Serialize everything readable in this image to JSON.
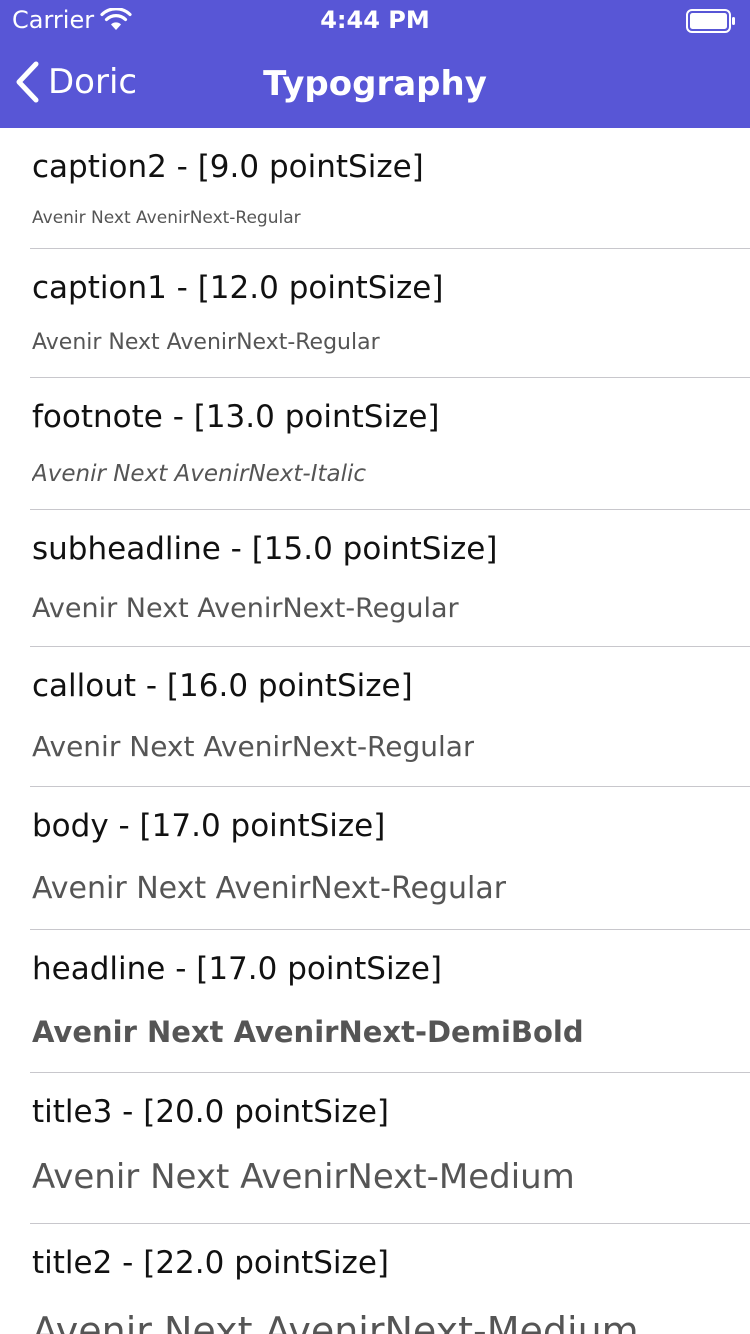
{
  "status_bar": {
    "carrier": "Carrier",
    "time": "4:44 PM"
  },
  "nav": {
    "back_label": "Doric",
    "title": "Typography"
  },
  "colors": {
    "nav_background": "#5856d6",
    "nav_text": "#ffffff",
    "title_text": "#111111",
    "sample_text": "#555555",
    "separator": "#c8c7cc"
  },
  "rows": [
    {
      "title": "caption2 - [9.0 pointSize]",
      "sample": "Avenir Next AvenirNext-Regular"
    },
    {
      "title": "caption1 - [12.0 pointSize]",
      "sample": "Avenir Next AvenirNext-Regular"
    },
    {
      "title": "footnote - [13.0 pointSize]",
      "sample": "Avenir Next AvenirNext-Italic"
    },
    {
      "title": "subheadline - [15.0 pointSize]",
      "sample": "Avenir Next AvenirNext-Regular"
    },
    {
      "title": "callout - [16.0 pointSize]",
      "sample": "Avenir Next AvenirNext-Regular"
    },
    {
      "title": "body - [17.0 pointSize]",
      "sample": "Avenir Next AvenirNext-Regular"
    },
    {
      "title": "headline - [17.0 pointSize]",
      "sample": "Avenir Next AvenirNext-DemiBold"
    },
    {
      "title": "title3 - [20.0 pointSize]",
      "sample": "Avenir Next AvenirNext-Medium"
    },
    {
      "title": "title2 - [22.0 pointSize]",
      "sample": "Avenir Next AvenirNext-Medium"
    }
  ]
}
